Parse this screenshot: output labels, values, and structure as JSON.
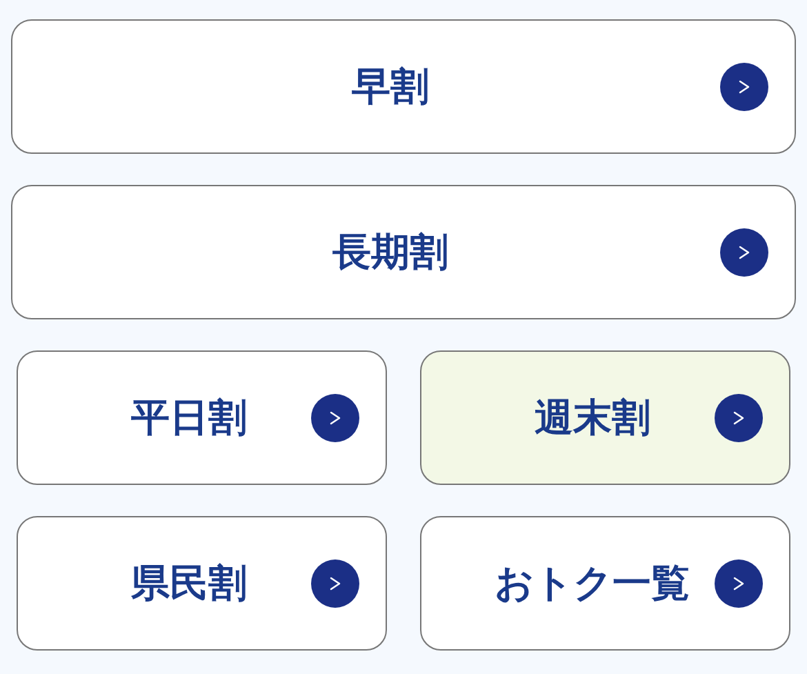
{
  "buttons": [
    {
      "label": "早割",
      "kind": "wide",
      "selected": false
    },
    {
      "label": "長期割",
      "kind": "wide",
      "selected": false
    },
    {
      "label": "平日割",
      "kind": "half",
      "selected": false
    },
    {
      "label": "週末割",
      "kind": "half",
      "selected": true
    },
    {
      "label": "県民割",
      "kind": "half",
      "selected": false
    },
    {
      "label": "おトク一覧",
      "kind": "half",
      "selected": false
    }
  ]
}
